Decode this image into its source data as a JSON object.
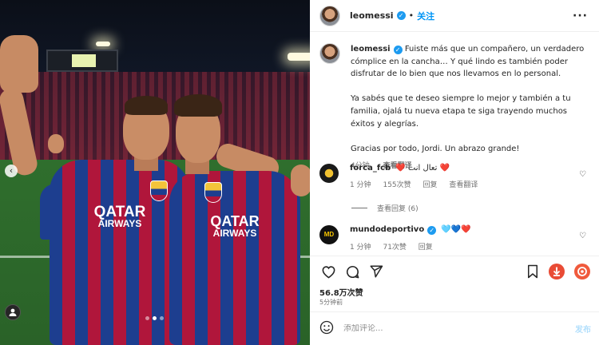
{
  "media": {
    "jersey_sponsor_line1": "QATAR",
    "jersey_sponsor_line2": "AIRWAYS",
    "arrow_icon": "chevron-left-icon",
    "user_badge_icon": "person-icon",
    "carousel_dots": 3,
    "carousel_active": 2
  },
  "header": {
    "username": "leomessi",
    "separator": "•",
    "follow_label": "关注",
    "more_label": "···"
  },
  "caption": {
    "username": "leomessi",
    "paragraphs": [
      "Fuiste más que un compañero, un verdadero cómplice en la cancha… Y qué lindo es también poder disfrutar de lo bien que nos llevamos en lo personal.",
      "Ya sabés que te deseo siempre lo mejor y también a tu familia, ojalá tu nueva etapa te siga trayendo muchos éxitos y alegrías.",
      "Gracias por todo, Jordi. Un abrazo grande!"
    ],
    "time": "4分钟",
    "translate": "查看翻译"
  },
  "comments": [
    {
      "username": "forca_fcb",
      "text": "❤️ تعال انت ❤️",
      "time": "1 分钟",
      "likes": "155次赞",
      "reply": "回复",
      "translate": "查看翻译",
      "view_replies": "查看回复 (6)"
    },
    {
      "username": "mundodeportivo",
      "avatar_text": "MD",
      "text": "🩵💙❤️",
      "time": "1 分钟",
      "likes": "71次赞",
      "reply": "回复"
    }
  ],
  "actions": {
    "likes": "56.8万次赞",
    "ago": "5分钟前"
  },
  "add_comment": {
    "placeholder": "添加评论...",
    "post_label": "发布"
  },
  "colors": {
    "accent": "#0095f6",
    "verified": "#1d9bf0",
    "muted": "#737373"
  }
}
